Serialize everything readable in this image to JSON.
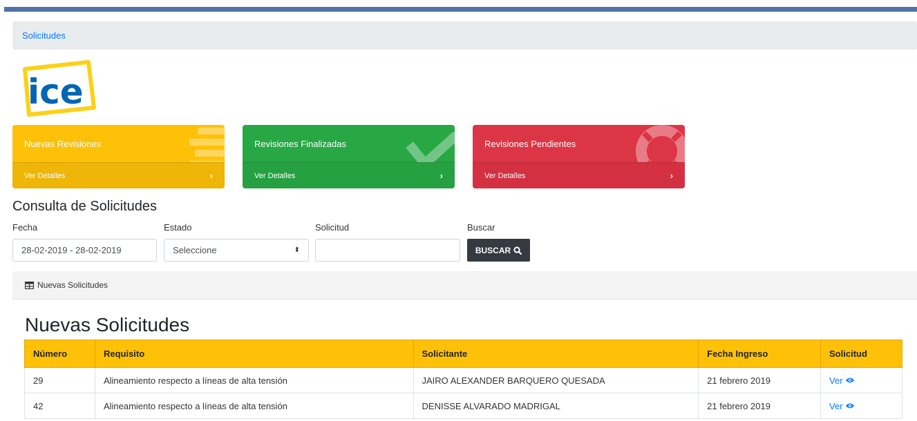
{
  "breadcrumb": {
    "label": "Solicitudes"
  },
  "logo": {
    "text": "ice",
    "colors": {
      "frame": "#fcd116",
      "text": "#0066b3"
    }
  },
  "cards": [
    {
      "title": "Nuevas Revisiones",
      "link": "Ver Detalles",
      "color": "#ffc107",
      "icon": "list-icon"
    },
    {
      "title": "Revisiones Finalizadas",
      "link": "Ver Detalles",
      "color": "#28a745",
      "icon": "check-icon"
    },
    {
      "title": "Revisiones Pendientes",
      "link": "Ver Detalles",
      "color": "#dc3545",
      "icon": "life-ring-icon"
    }
  ],
  "query": {
    "title": "Consulta de Solicitudes",
    "fecha_label": "Fecha",
    "fecha_value": "28-02-2019 - 28-02-2019",
    "estado_label": "Estado",
    "estado_value": "Seleccione",
    "solicitud_label": "Solicitud",
    "solicitud_value": "",
    "buscar_label": "Buscar",
    "buscar_button": "BUSCAR"
  },
  "panel": {
    "label": "Nuevas Solicitudes"
  },
  "table": {
    "title": "Nuevas Solicitudes",
    "headers": [
      "Número",
      "Requisito",
      "Solicitante",
      "Fecha Ingreso",
      "Solicitud"
    ],
    "rows": [
      {
        "numero": "29",
        "requisito": "Alineamiento respecto a líneas de alta tensión",
        "solicitante": "JAIRO ALEXANDER BARQUERO QUESADA",
        "fecha": "21 febrero 2019",
        "accion": "Ver"
      },
      {
        "numero": "42",
        "requisito": "Alineamiento respecto a líneas de alta tensión",
        "solicitante": "DENISSE ALVARADO MADRIGAL",
        "fecha": "21 febrero 2019",
        "accion": "Ver"
      }
    ]
  }
}
